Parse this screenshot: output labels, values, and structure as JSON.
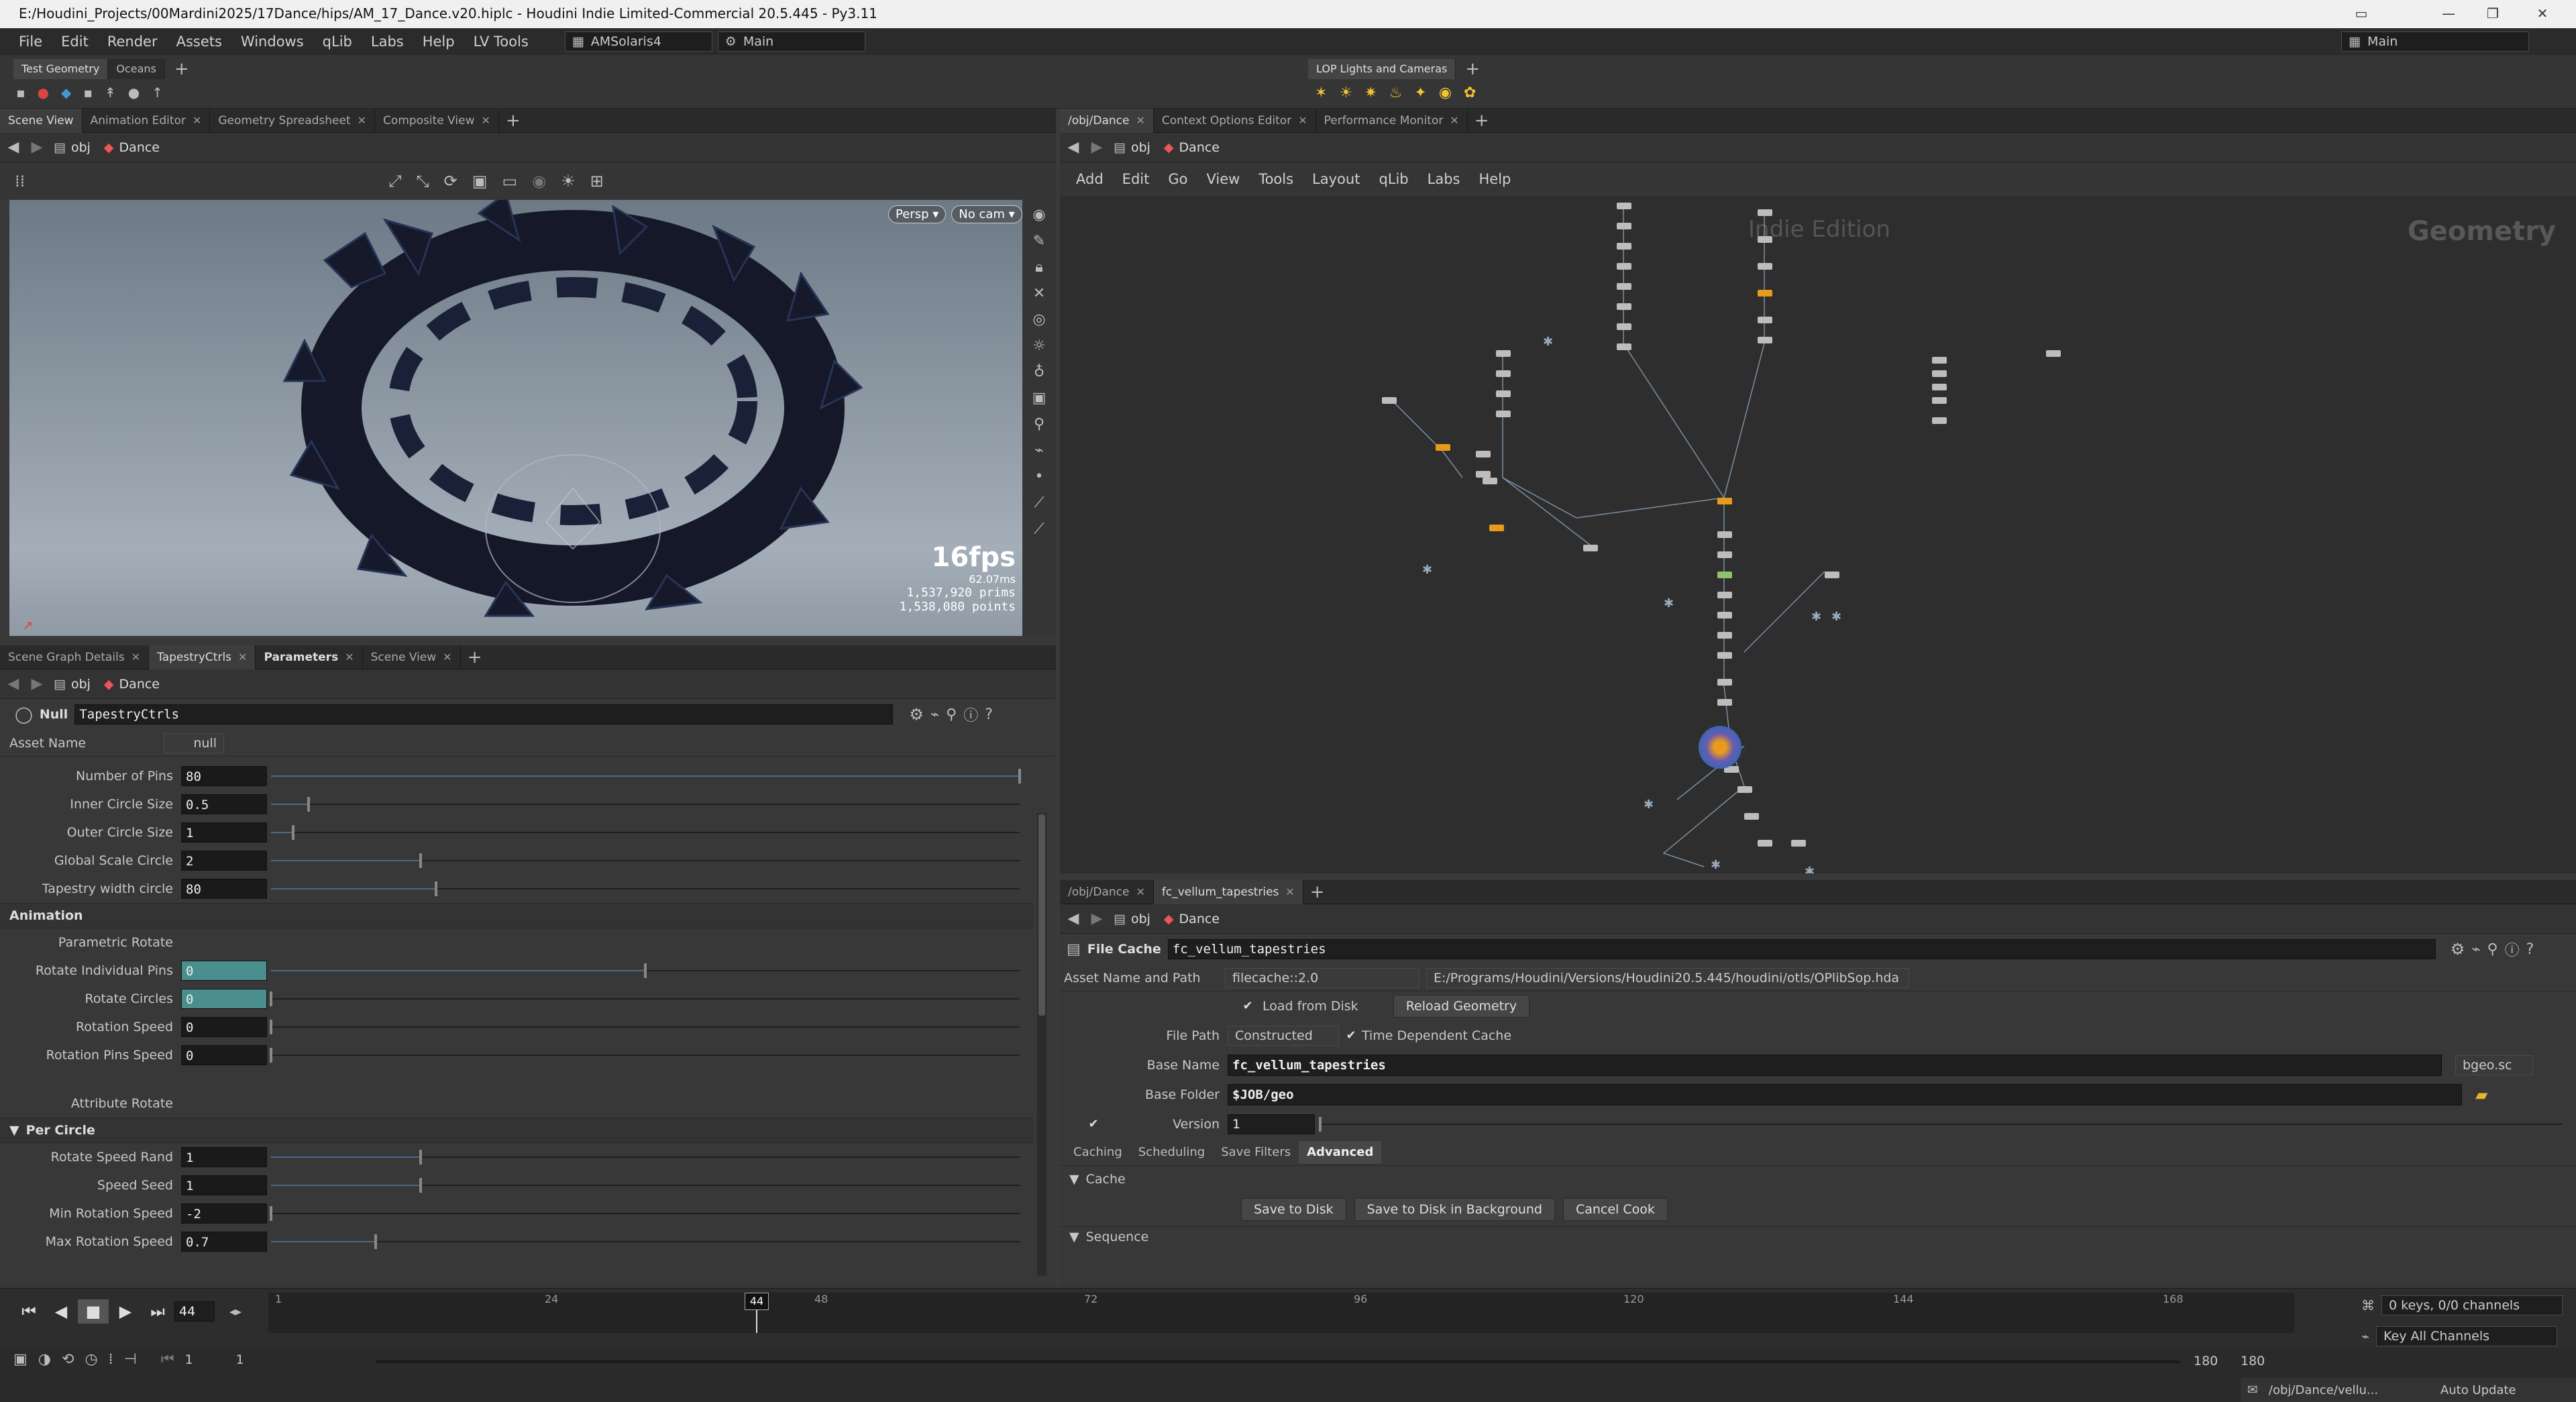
{
  "window": {
    "title": "E:/Houdini_Projects/00Mardini2025/17Dance/hips/AM_17_Dance.v20.hiplc - Houdini Indie Limited-Commercial 20.5.445 - Py3.11"
  },
  "menu": [
    "File",
    "Edit",
    "Render",
    "Assets",
    "Windows",
    "qLib",
    "Labs",
    "Help",
    "LV Tools"
  ],
  "desktop": "AMSolaris4",
  "desktop_main": "Main",
  "main_right": "Main",
  "shelf": {
    "tabs": [
      "Test Geometry",
      "Oceans"
    ],
    "lop_tab": "LOP Lights and Cameras"
  },
  "left_top": {
    "tabs": [
      "Scene View",
      "Animation Editor",
      "Geometry Spreadsheet",
      "Composite View"
    ],
    "path": [
      "obj",
      "Dance"
    ],
    "persp": "Persp",
    "cam": "No cam",
    "fps": "16fps",
    "ms": "62.07ms",
    "prims": "1,537,920  prims",
    "points": "1,538,080 points"
  },
  "left_bottom": {
    "tabs": [
      "Scene Graph Details",
      "TapestryCtrls",
      "Parameters",
      "Scene View"
    ],
    "path": [
      "obj",
      "Dance"
    ],
    "node_type": "Null",
    "node_name": "TapestryCtrls",
    "asset_label": "Asset Name",
    "asset_value": "null",
    "parms1": [
      {
        "label": "Number of Pins",
        "value": "80",
        "frac": 1.0
      },
      {
        "label": "Inner Circle Size",
        "value": "0.5",
        "frac": 0.05
      },
      {
        "label": "Outer Circle Size",
        "value": "1",
        "frac": 0.03
      },
      {
        "label": "Global Scale Circle",
        "value": "2",
        "frac": 0.2
      },
      {
        "label": "Tapestry width circle",
        "value": "80",
        "frac": 0.22
      }
    ],
    "section_animation": "Animation",
    "parametric_label": "Parametric Rotate",
    "parms2": [
      {
        "label": "Rotate Individual Pins",
        "value": "0",
        "frac": 0.5,
        "teal": true
      },
      {
        "label": "Rotate Circles",
        "value": "0",
        "frac": 0.0,
        "teal": true
      },
      {
        "label": "Rotation Speed",
        "value": "0",
        "frac": 0.0
      },
      {
        "label": "Rotation Pins Speed",
        "value": "0",
        "frac": 0.0
      }
    ],
    "attribute_label": "Attribute Rotate",
    "section_percircle": "Per Circle",
    "parms3": [
      {
        "label": "Rotate Speed Rand",
        "value": "1",
        "frac": 0.2
      },
      {
        "label": "Speed Seed",
        "value": "1",
        "frac": 0.2
      },
      {
        "label": "Min Rotation Speed",
        "value": "-2",
        "frac": 0.0
      },
      {
        "label": "Max Rotation Speed",
        "value": "0.7",
        "frac": 0.14
      }
    ]
  },
  "right_top": {
    "tabs": [
      "/obj/Dance",
      "Context Options Editor",
      "Performance Monitor"
    ],
    "path": [
      "obj",
      "Dance"
    ],
    "menu": [
      "Add",
      "Edit",
      "Go",
      "View",
      "Tools",
      "Layout",
      "qLib",
      "Labs",
      "Help"
    ],
    "watermark": "Indie Edition",
    "context": "Geometry"
  },
  "right_bottom": {
    "tabs": [
      "/obj/Dance",
      "fc_vellum_tapestries"
    ],
    "path": [
      "obj",
      "Dance"
    ],
    "node_type": "File Cache",
    "node_name": "fc_vellum_tapestries",
    "asset_label": "Asset Name and Path",
    "asset_name": "filecache::2.0",
    "asset_path": "E:/Programs/Houdini/Versions/Houdini20.5.445/houdini/otls/OPlibSop.hda",
    "load_from_disk": "Load from Disk",
    "reload": "Reload Geometry",
    "file_path_label": "File Path",
    "file_path_value": "Constructed",
    "time_dep": "Time Dependent Cache",
    "base_name_label": "Base Name",
    "base_name": "fc_vellum_tapestries",
    "ext": "bgeo.sc",
    "base_folder_label": "Base Folder",
    "base_folder": "$JOB/geo",
    "version_label": "Version",
    "version": "1",
    "subtabs": [
      "Caching",
      "Scheduling",
      "Save Filters",
      "Advanced"
    ],
    "cache_section": "Cache",
    "buttons": [
      "Save to Disk",
      "Save to Disk in Background",
      "Cancel Cook"
    ],
    "sequence_section": "Sequence"
  },
  "timeline": {
    "frame": "44",
    "current_marker": "44",
    "ticks": [
      "1",
      "24",
      "48",
      "72",
      "96",
      "120",
      "144",
      "168"
    ],
    "range_start": "1",
    "range_start2": "1",
    "range_end": "180",
    "range_end2": "180",
    "keys": "0 keys, 0/0 channels",
    "key_all": "Key All Channels"
  },
  "status": {
    "path": "/obj/Dance/vellu...",
    "update": "Auto Update"
  }
}
